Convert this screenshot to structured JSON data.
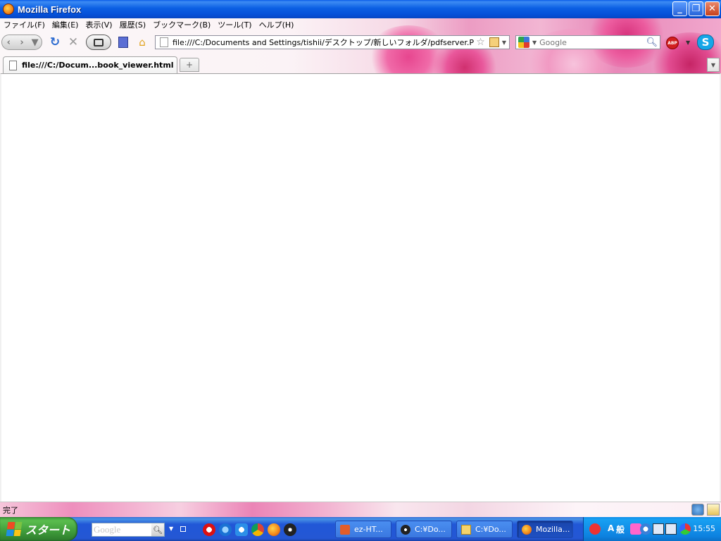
{
  "window": {
    "title": "Mozilla Firefox",
    "minimize_label": "_",
    "maximize_label": "❐",
    "close_label": "✕"
  },
  "menu": {
    "items": [
      {
        "label": "ファイル(F)"
      },
      {
        "label": "編集(E)"
      },
      {
        "label": "表示(V)"
      },
      {
        "label": "履歴(S)"
      },
      {
        "label": "ブックマーク(B)"
      },
      {
        "label": "ツール(T)"
      },
      {
        "label": "ヘルプ(H)"
      }
    ]
  },
  "navbar": {
    "back": "‹",
    "forward": "›",
    "reload": "↻",
    "stop": "✕",
    "home": "⌂",
    "url": "file:///C:/Documents and Settings/tishii/デスクトップ/新しいフォルダ/pdfserver.PNG",
    "search_placeholder": "Google",
    "abp_label": "ABP",
    "skype_label": "S"
  },
  "tabs": {
    "active": "file:///C:/Docum...book_viewer.html",
    "new_tab": "+"
  },
  "status": {
    "text": "完了"
  },
  "taskbar": {
    "start_label": "スタート",
    "google_text": "Google",
    "tasks": [
      {
        "label": "ez-HT..."
      },
      {
        "label": "C:¥Do..."
      },
      {
        "label": "C:¥Do..."
      },
      {
        "label": "Mozilla..."
      }
    ],
    "ime_a": "A",
    "ime_mode": "般",
    "clock": "15:55"
  },
  "colors": {
    "xp_blue": "#0550d8",
    "start_green": "#3f9c3a",
    "tray_blue": "#0d82e0",
    "flower_pink": "#e7468f"
  }
}
